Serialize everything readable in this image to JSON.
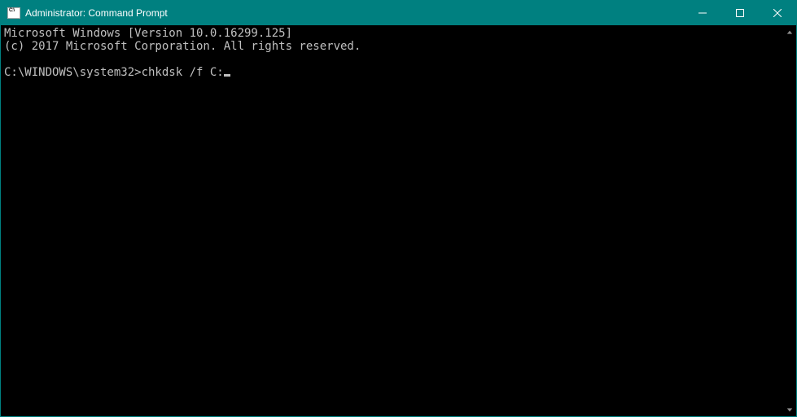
{
  "titlebar": {
    "icon_label": "C:\\",
    "title": "Administrator: Command Prompt"
  },
  "terminal": {
    "line1": "Microsoft Windows [Version 10.0.16299.125]",
    "line2": "(c) 2017 Microsoft Corporation. All rights reserved.",
    "blank1": "",
    "prompt": "C:\\WINDOWS\\system32>",
    "command": "chkdsk /f C:"
  }
}
